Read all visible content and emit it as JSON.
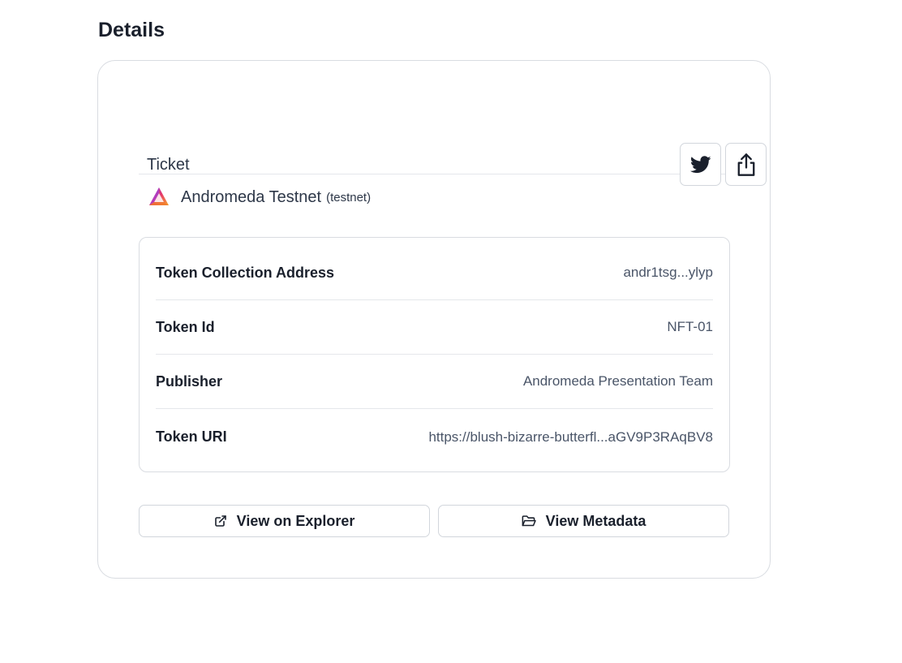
{
  "page": {
    "title": "Details"
  },
  "card": {
    "header": {
      "ticket_label": "Ticket",
      "twitter_icon": "twitter-icon",
      "share_icon": "share-icon"
    },
    "chain": {
      "logo_icon": "andromeda-logo-icon",
      "name": "Andromeda Testnet",
      "tag": "(testnet)"
    },
    "details": [
      {
        "label": "Token Collection Address",
        "value": "andr1tsg...ylyp"
      },
      {
        "label": "Token Id",
        "value": "NFT-01"
      },
      {
        "label": "Publisher",
        "value": "Andromeda Presentation Team"
      },
      {
        "label": "Token URI",
        "value": "https://blush-bizarre-butterfl...aGV9P3RAqBV8"
      }
    ],
    "actions": {
      "explorer_label": "View on Explorer",
      "explorer_icon": "external-link-icon",
      "metadata_label": "View Metadata",
      "metadata_icon": "folder-open-icon"
    }
  },
  "colors": {
    "text_primary": "#1a202c",
    "text_secondary": "#4a5568",
    "border": "#d9dce1"
  }
}
